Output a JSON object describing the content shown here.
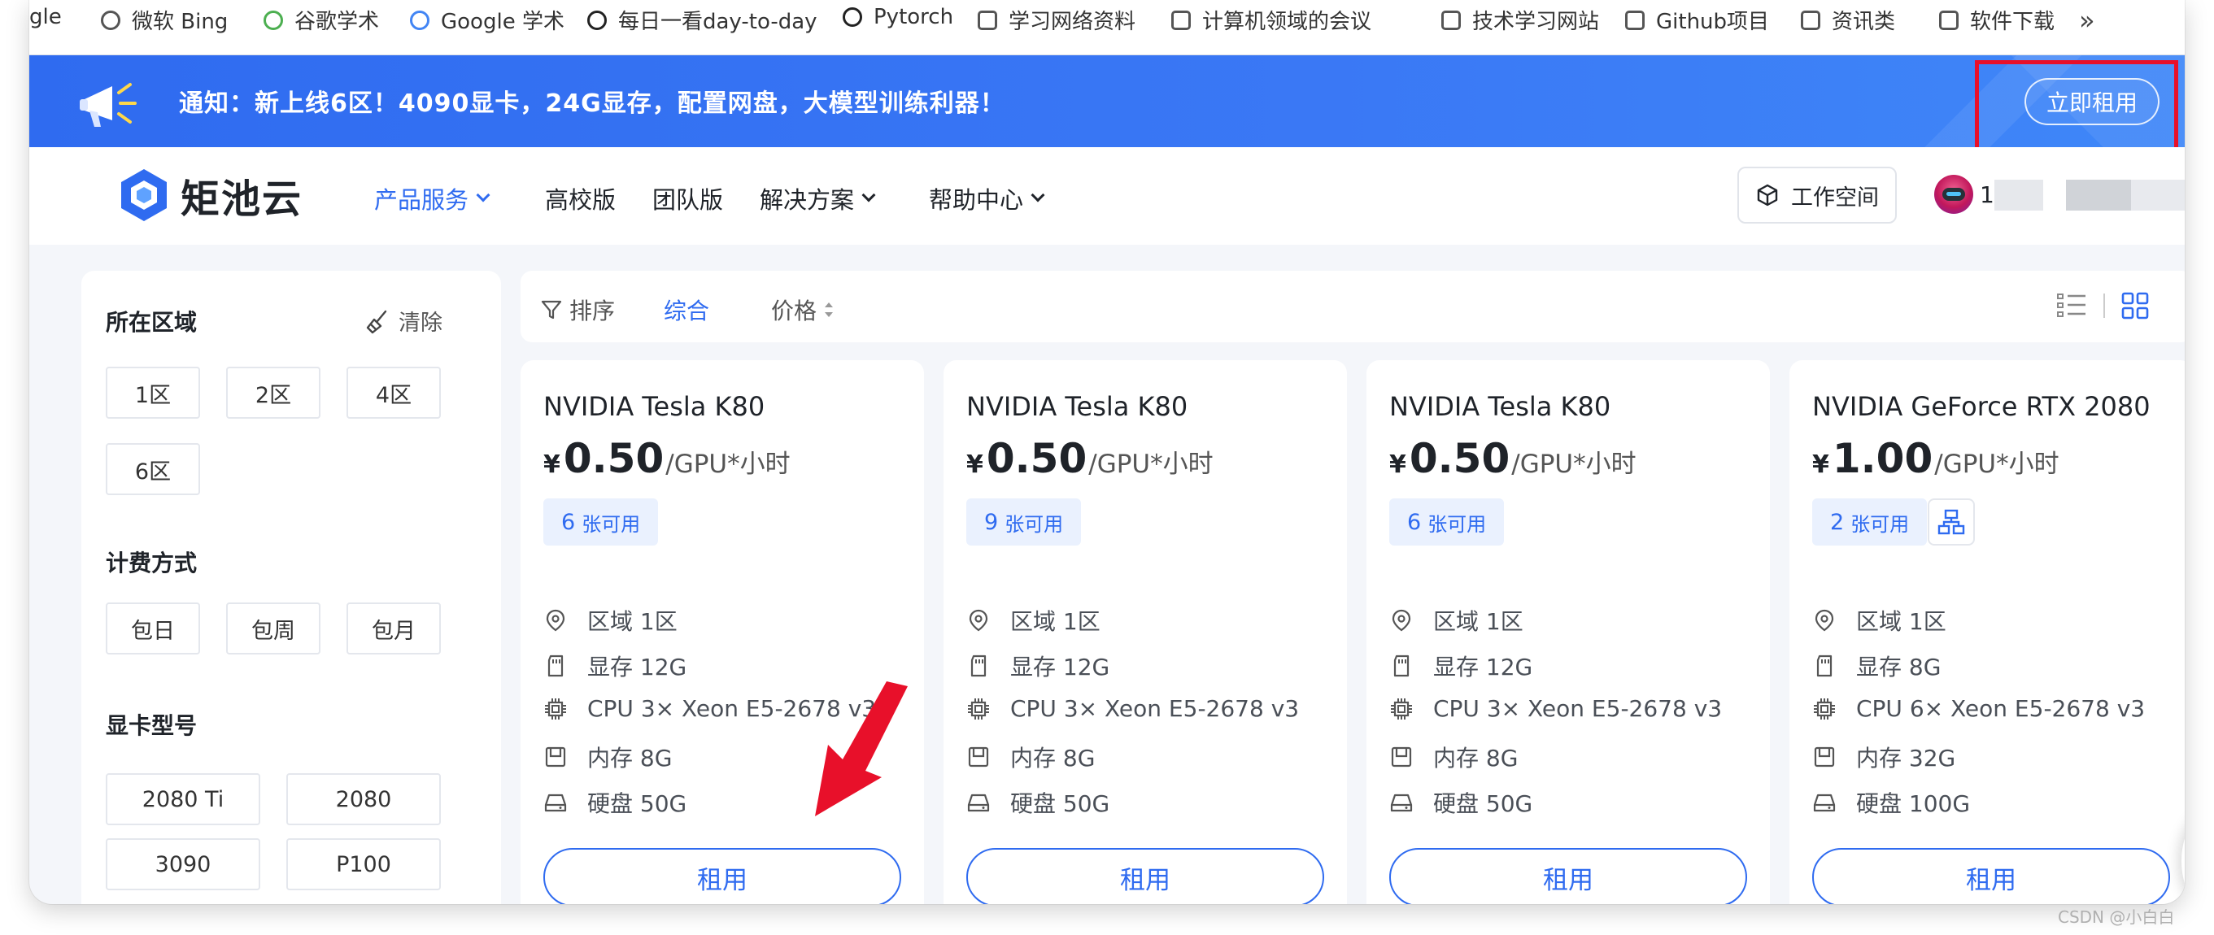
{
  "bookmarks": [
    {
      "label": "gle",
      "icon": "none"
    },
    {
      "label": "微软 Bing",
      "icon": "search-icon"
    },
    {
      "label": "谷歌学术",
      "icon": "scholar-icon"
    },
    {
      "label": "Google 学术",
      "icon": "scholar-icon"
    },
    {
      "label": "每日一看day-to-day",
      "icon": "github-icon"
    },
    {
      "label": "Pytorch",
      "icon": "pytorch-icon"
    },
    {
      "label": "学习网络资料",
      "icon": "folder-icon"
    },
    {
      "label": "计算机领域的会议",
      "icon": "folder-icon"
    },
    {
      "label": "技术学习网站",
      "icon": "folder-icon"
    },
    {
      "label": "Github项目",
      "icon": "folder-icon"
    },
    {
      "label": "资讯类",
      "icon": "folder-icon"
    },
    {
      "label": "软件下载",
      "icon": "folder-icon"
    }
  ],
  "bookmarks_more": "»",
  "banner": {
    "text": "通知：新上线6区！4090显卡，24G显存，配置网盘，大模型训练利器！",
    "button": "立即租用",
    "icon": "megaphone-icon"
  },
  "brand": {
    "name": "矩池云"
  },
  "nav": {
    "items": [
      {
        "label": "产品服务",
        "dropdown": true,
        "active": true
      },
      {
        "label": "高校版",
        "dropdown": false
      },
      {
        "label": "团队版",
        "dropdown": false
      },
      {
        "label": "解决方案",
        "dropdown": true
      },
      {
        "label": "帮助中心",
        "dropdown": true
      }
    ],
    "workspace": "工作空间",
    "user_initial": "1"
  },
  "filters": {
    "region_title": "所在区域",
    "clear": "清除",
    "regions": [
      "1区",
      "2区",
      "4区",
      "6区"
    ],
    "billing_title": "计费方式",
    "billing": [
      "包日",
      "包周",
      "包月"
    ],
    "gpu_title": "显卡型号",
    "gpus": [
      "2080 Ti",
      "2080",
      "3090",
      "P100"
    ]
  },
  "sort": {
    "label": "排序",
    "comprehensive": "综合",
    "price": "价格",
    "active": "综合"
  },
  "cards": [
    {
      "title": "NVIDIA Tesla K80",
      "yen": "¥",
      "price": "0.50",
      "unit": "/GPU*小时",
      "available_num": "6",
      "available_label": "张可用",
      "has_network": false,
      "region": "区域 1区",
      "vram": "显存 12G",
      "cpu": "CPU 3× Xeon E5-2678 v3",
      "ram": "内存 8G",
      "disk": "硬盘 50G",
      "button": "租用"
    },
    {
      "title": "NVIDIA Tesla K80",
      "yen": "¥",
      "price": "0.50",
      "unit": "/GPU*小时",
      "available_num": "9",
      "available_label": "张可用",
      "has_network": false,
      "region": "区域 1区",
      "vram": "显存 12G",
      "cpu": "CPU 3× Xeon E5-2678 v3",
      "ram": "内存 8G",
      "disk": "硬盘 50G",
      "button": "租用"
    },
    {
      "title": "NVIDIA Tesla K80",
      "yen": "¥",
      "price": "0.50",
      "unit": "/GPU*小时",
      "available_num": "6",
      "available_label": "张可用",
      "has_network": false,
      "region": "区域 1区",
      "vram": "显存 12G",
      "cpu": "CPU 3× Xeon E5-2678 v3",
      "ram": "内存 8G",
      "disk": "硬盘 50G",
      "button": "租用"
    },
    {
      "title": "NVIDIA GeForce RTX 2080",
      "yen": "¥",
      "price": "1.00",
      "unit": "/GPU*小时",
      "available_num": "2",
      "available_label": "张可用",
      "has_network": true,
      "region": "区域 1区",
      "vram": "显存 8G",
      "cpu": "CPU 6× Xeon E5-2678 v3",
      "ram": "内存 32G",
      "disk": "硬盘 100G",
      "button": "租用"
    }
  ],
  "watermark": "CSDN @小白白",
  "colors": {
    "accent": "#2f6bf0",
    "annotation": "#e8102a"
  }
}
